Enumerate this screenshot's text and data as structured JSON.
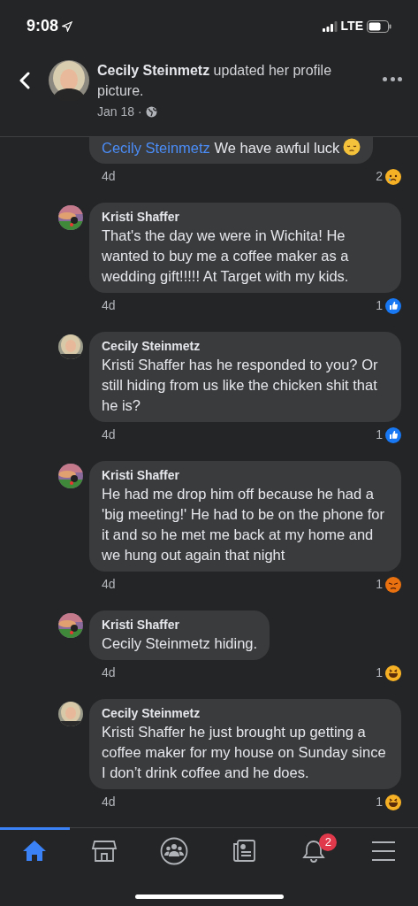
{
  "status_bar": {
    "time": "9:08",
    "network": "LTE"
  },
  "header": {
    "author": "Cecily Steinmetz",
    "action": "updated her profile picture.",
    "date": "Jan 18 ·"
  },
  "comments": [
    {
      "cut": true,
      "mention": "Cecily Steinmetz",
      "text": "We have awful luck",
      "emoji": {
        "kind": "pensive"
      },
      "time": "4d",
      "reaction": {
        "kind": "sad",
        "count": "2"
      }
    },
    {
      "avatar": {
        "kind": "sunset"
      },
      "author": "Kristi Shaffer",
      "text": "That's the day we were in Wichita! He wanted to buy me a coffee maker as a wedding gift!!!!! At Target with my kids.",
      "time": "4d",
      "reaction": {
        "kind": "like",
        "count": "1"
      }
    },
    {
      "avatar": {
        "kind": "portrait"
      },
      "author": "Cecily Steinmetz",
      "text": "Kristi Shaffer has he responded to you? Or still hiding from us like the chicken shit that he is?",
      "time": "4d",
      "reaction": {
        "kind": "like",
        "count": "1"
      }
    },
    {
      "avatar": {
        "kind": "sunset"
      },
      "author": "Kristi Shaffer",
      "text": "He had me drop him off because he had a 'big meeting!' He had to be on the phone for it and so he met me back at my home and we hung out again that night",
      "time": "4d",
      "reaction": {
        "kind": "angry",
        "count": "1"
      }
    },
    {
      "avatar": {
        "kind": "sunset"
      },
      "author": "Kristi Shaffer",
      "text": "Cecily Steinmetz hiding.",
      "time": "4d",
      "reaction": {
        "kind": "haha",
        "count": "1"
      }
    },
    {
      "avatar": {
        "kind": "portrait"
      },
      "author": "Cecily Steinmetz",
      "text": "Kristi Shaffer he just brought up getting a coffee maker for my house on Sunday since I don’t drink coffee and he does.",
      "time": "4d",
      "reaction": {
        "kind": "haha",
        "count": "1"
      }
    }
  ],
  "tabs": [
    {
      "kind": "home",
      "selected": true
    },
    {
      "kind": "marketplace",
      "selected": false
    },
    {
      "kind": "groups",
      "selected": false
    },
    {
      "kind": "news",
      "selected": false
    },
    {
      "kind": "notifications",
      "selected": false,
      "badge": "2"
    },
    {
      "kind": "menu",
      "selected": false
    }
  ]
}
